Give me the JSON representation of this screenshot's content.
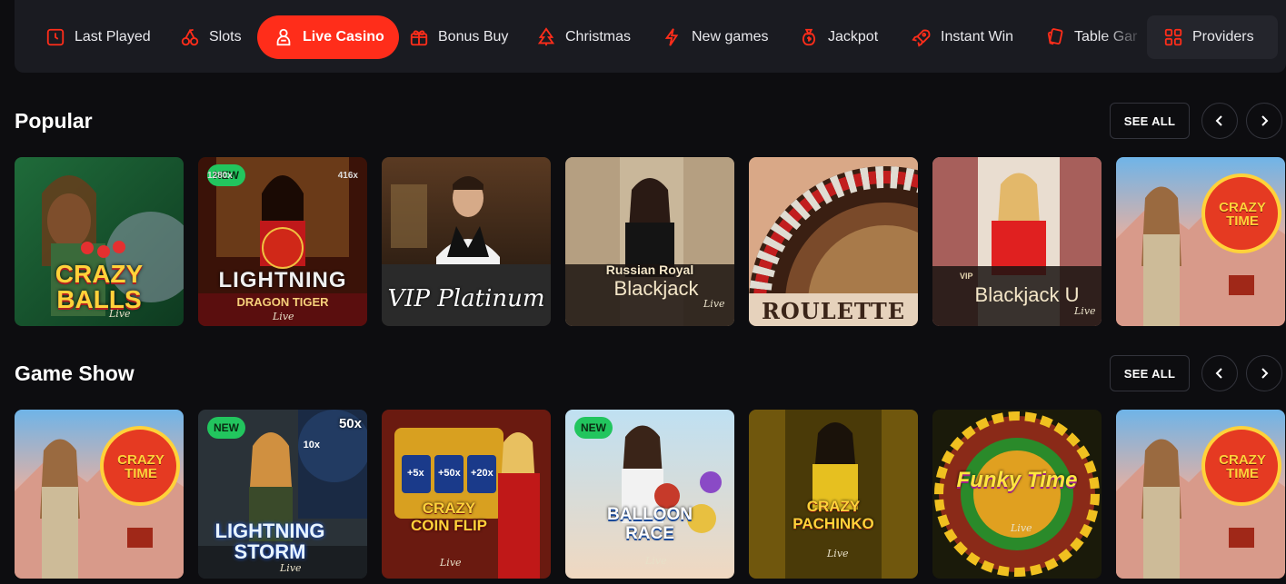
{
  "categories": [
    {
      "label": "Last Played",
      "icon": "clock-icon"
    },
    {
      "label": "Slots",
      "icon": "cherries-icon"
    },
    {
      "label": "Live Casino",
      "icon": "dealer-icon",
      "active": true
    },
    {
      "label": "Bonus Buy",
      "icon": "gift-icon"
    },
    {
      "label": "Christmas",
      "icon": "tree-icon"
    },
    {
      "label": "New games",
      "icon": "lightning-icon"
    },
    {
      "label": "Jackpot",
      "icon": "money-bag-icon"
    },
    {
      "label": "Instant Win",
      "icon": "rocket-icon"
    },
    {
      "label": "Table Gar",
      "icon": "cards-icon"
    },
    {
      "label": "Providers",
      "icon": "grid-icon"
    }
  ],
  "sections": [
    {
      "title": "Popular",
      "see_all": "SEE ALL",
      "games": [
        {
          "title": "CRAZY BALLS",
          "sub": "Live",
          "new": false
        },
        {
          "title": "LIGHTNING",
          "sub": "DRAGON TIGER",
          "extra": "Live",
          "badges": [
            "1280x",
            "416x"
          ],
          "new": true,
          "badge": "NEW"
        },
        {
          "title": "VIP Platinum",
          "new": false
        },
        {
          "title": "Blackjack",
          "sub": "Russian Royal",
          "extra": "Live",
          "new": false
        },
        {
          "title": "ROULETTE",
          "new": false
        },
        {
          "title": "Blackjack U",
          "sub": "VIP",
          "extra": "Live",
          "new": false
        },
        {
          "title": "CRAZY TIME",
          "new": false
        }
      ]
    },
    {
      "title": "Game Show",
      "see_all": "SEE ALL",
      "games": [
        {
          "title": "CRAZY TIME",
          "new": false
        },
        {
          "title": "LIGHTNING STORM",
          "sub": "Live",
          "extra": "50x",
          "badges": [
            "10x"
          ],
          "new": true,
          "badge": "NEW"
        },
        {
          "title": "CRAZY COIN FLIP",
          "sub": "Live",
          "badges": [
            "+5x",
            "+50x",
            "+20x"
          ],
          "new": false
        },
        {
          "title": "BALLOON RACE",
          "sub": "Live",
          "new": true,
          "badge": "NEW"
        },
        {
          "title": "CRAZY PACHINKO",
          "sub": "Live",
          "new": false
        },
        {
          "title": "Funky Time",
          "sub": "Live",
          "new": false
        },
        {
          "title": "CRAZY TIME",
          "new": false
        }
      ]
    }
  ],
  "colors": {
    "accent": "#ff2d1a",
    "new_badge": "#22c55e",
    "bg": "#0d0d10",
    "bar": "#1a1b21"
  }
}
